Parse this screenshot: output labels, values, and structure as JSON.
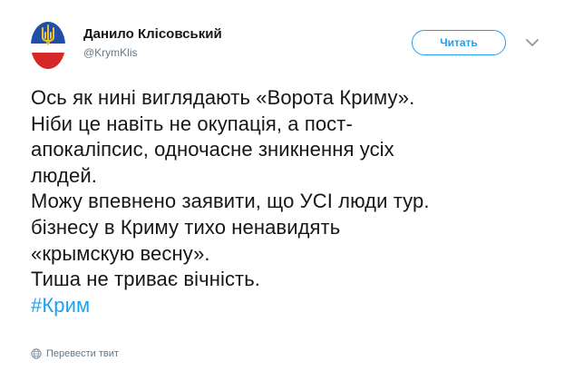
{
  "author": {
    "display_name": "Данило Клісовський",
    "handle": "@KrymKlis",
    "avatar_icon": "trident-flag-avatar"
  },
  "actions": {
    "follow_label": "Читать",
    "menu_icon": "chevron-down-icon"
  },
  "tweet": {
    "lines": [
      "Ось як нині виглядають «Ворота Криму».",
      "Ніби це навіть не окупація, а пост-",
      "апокаліпсис, одночасне зникнення усіх",
      "людей.",
      "Можу впевнено заявити, що УСІ люди тур.",
      "бізнесу в Криму тихо ненавидять",
      "«крымскую весну».",
      "Тиша не триває вічність."
    ],
    "hashtag": "#Крим"
  },
  "translate": {
    "label": "Перевести твит",
    "icon": "globe-icon"
  },
  "colors": {
    "accent": "#1da1f2",
    "text": "#14171a",
    "muted": "#657786",
    "flag_blue": "#1f4fa8",
    "flag_red": "#d62828",
    "trident_gold": "#f2c12e"
  }
}
